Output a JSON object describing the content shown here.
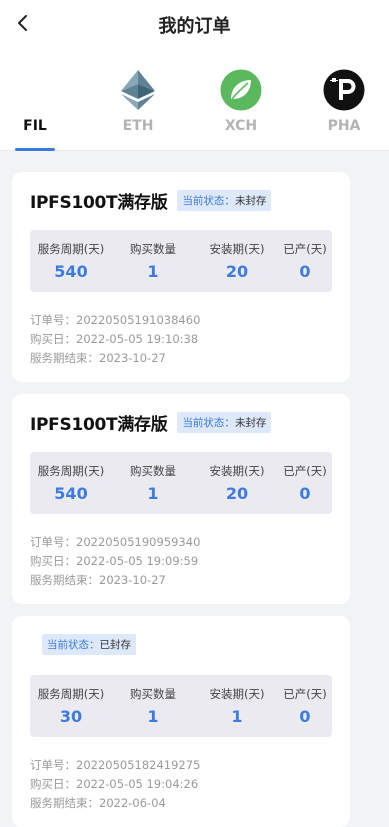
{
  "header": {
    "title": "我的订单",
    "back_icon": "chevron-left-icon"
  },
  "tabs": [
    {
      "label": "FIL",
      "icon": "",
      "active": true
    },
    {
      "label": "ETH",
      "icon": "ethereum-icon",
      "active": false
    },
    {
      "label": "XCH",
      "icon": "chia-leaf-icon",
      "active": false
    },
    {
      "label": "PHA",
      "icon": "phala-icon",
      "active": false
    }
  ],
  "status_label": "当前状态：",
  "stat_labels": {
    "period": "服务周期(天)",
    "qty": "购买数量",
    "install": "安装期(天)",
    "produced": "已产(天)"
  },
  "info_labels": {
    "order_no": "订单号：",
    "purchase_date": "购买日：",
    "service_end": "服务期结束："
  },
  "orders": [
    {
      "product": "IPFS100T满存版",
      "status": "未封存",
      "period": "540",
      "qty": "1",
      "install": "20",
      "produced": "0",
      "order_no": "20220505191038460",
      "purchase_date": "2022-05-05 19:10:38",
      "service_end": "2023-10-27"
    },
    {
      "product": "IPFS100T满存版",
      "status": "未封存",
      "period": "540",
      "qty": "1",
      "install": "20",
      "produced": "0",
      "order_no": "20220505190959340",
      "purchase_date": "2022-05-05 19:09:59",
      "service_end": "2023-10-27"
    },
    {
      "product": "",
      "status": "已封存",
      "period": "30",
      "qty": "1",
      "install": "1",
      "produced": "0",
      "order_no": "20220505182419275",
      "purchase_date": "2022-05-05 19:04:26",
      "service_end": "2022-06-04"
    }
  ],
  "colors": {
    "accent": "#3e7be0",
    "badge_bg": "#dde9fb",
    "stats_bg": "#ebeaf0",
    "page_bg": "#f2f3f5"
  }
}
